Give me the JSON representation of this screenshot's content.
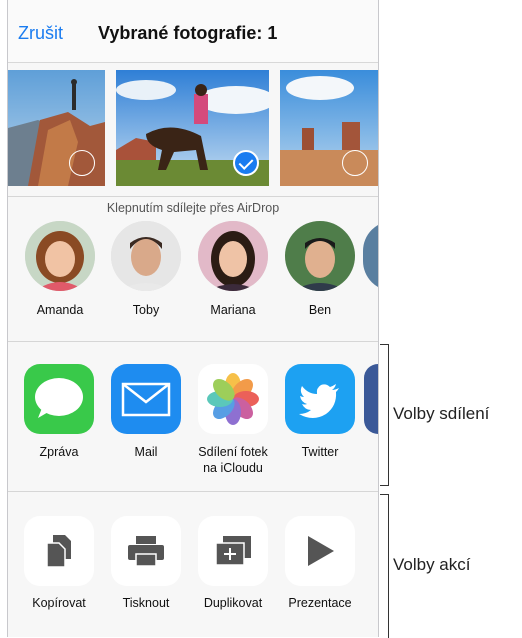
{
  "header": {
    "cancel_label": "Zrušit",
    "title": "Vybrané fotografie: 1"
  },
  "photos": [
    {
      "subject": "hiker on rock cliff",
      "selected": false
    },
    {
      "subject": "rider on horse in desert",
      "selected": true
    },
    {
      "subject": "desert buttes landscape",
      "selected": false
    }
  ],
  "airdrop": {
    "label": "Klepnutím sdílejte přes AirDrop",
    "people": [
      {
        "name": "Amanda"
      },
      {
        "name": "Toby"
      },
      {
        "name": "Mariana"
      },
      {
        "name": "Ben"
      }
    ]
  },
  "share_apps": [
    {
      "name": "Zpráva",
      "icon": "messages-icon",
      "color": "#39c94a"
    },
    {
      "name": "Mail",
      "icon": "mail-icon",
      "color": "#1e8cf0"
    },
    {
      "name": "Sdílení fotek na iCloudu",
      "icon": "photos-icon",
      "color": "#ffffff"
    },
    {
      "name": "Twitter",
      "icon": "twitter-icon",
      "color": "#1da1f2"
    }
  ],
  "actions": [
    {
      "name": "Kopírovat",
      "icon": "copy-icon"
    },
    {
      "name": "Tisknout",
      "icon": "print-icon"
    },
    {
      "name": "Duplikovat",
      "icon": "duplicate-icon"
    },
    {
      "name": "Prezentace",
      "icon": "slideshow-icon"
    }
  ],
  "callouts": {
    "share": "Volby sdílení",
    "actions": "Volby akcí"
  },
  "colors": {
    "accent": "#1a7cf0",
    "sheet_bg": "#f7f7f7",
    "icon_gray": "#555555"
  }
}
